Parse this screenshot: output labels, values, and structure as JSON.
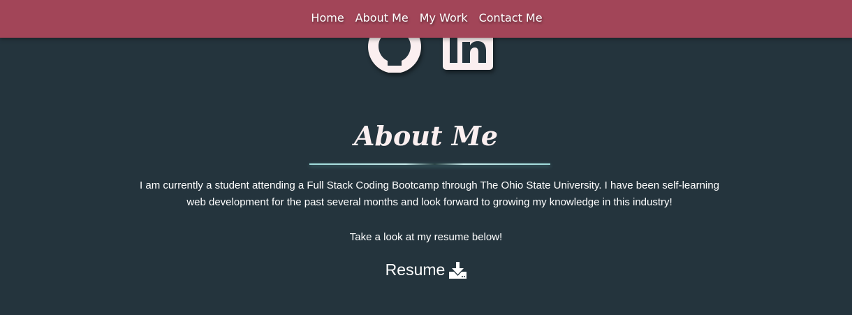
{
  "nav": {
    "items": [
      {
        "label": "Home"
      },
      {
        "label": "About Me"
      },
      {
        "label": "My Work"
      },
      {
        "label": "Contact Me"
      }
    ]
  },
  "social": {
    "icons": [
      "github-icon",
      "linkedin-icon"
    ]
  },
  "about": {
    "title": "About Me",
    "paragraph": "I am currently a student attending a Full Stack Coding Bootcamp through The Ohio State University. I have been self-learning web development for the past several months and look forward to growing my knowledge in this industry!",
    "resume_prompt": "Take a look at my resume below!",
    "resume_label": "Resume",
    "resume_icon": "download-icon"
  },
  "colors": {
    "navbar": "#a24558",
    "background": "#24343d",
    "text": "#ffffff",
    "icon": "#fbeff0",
    "divider": "#9fdcdc"
  }
}
